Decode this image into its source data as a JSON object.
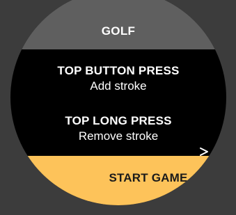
{
  "header": {
    "title": "GOLF"
  },
  "instructions": [
    {
      "title": "TOP BUTTON PRESS",
      "description": "Add stroke"
    },
    {
      "title": "TOP LONG PRESS",
      "description": "Remove stroke"
    }
  ],
  "action": {
    "label": "START GAME",
    "icon": "chevron-right-icon"
  },
  "colors": {
    "background": "#3c3c3c",
    "header": "#5f5f5f",
    "face": "#000000",
    "accent": "#fdc35a",
    "text": "#ffffff",
    "action_text": "#1a1a1a"
  }
}
